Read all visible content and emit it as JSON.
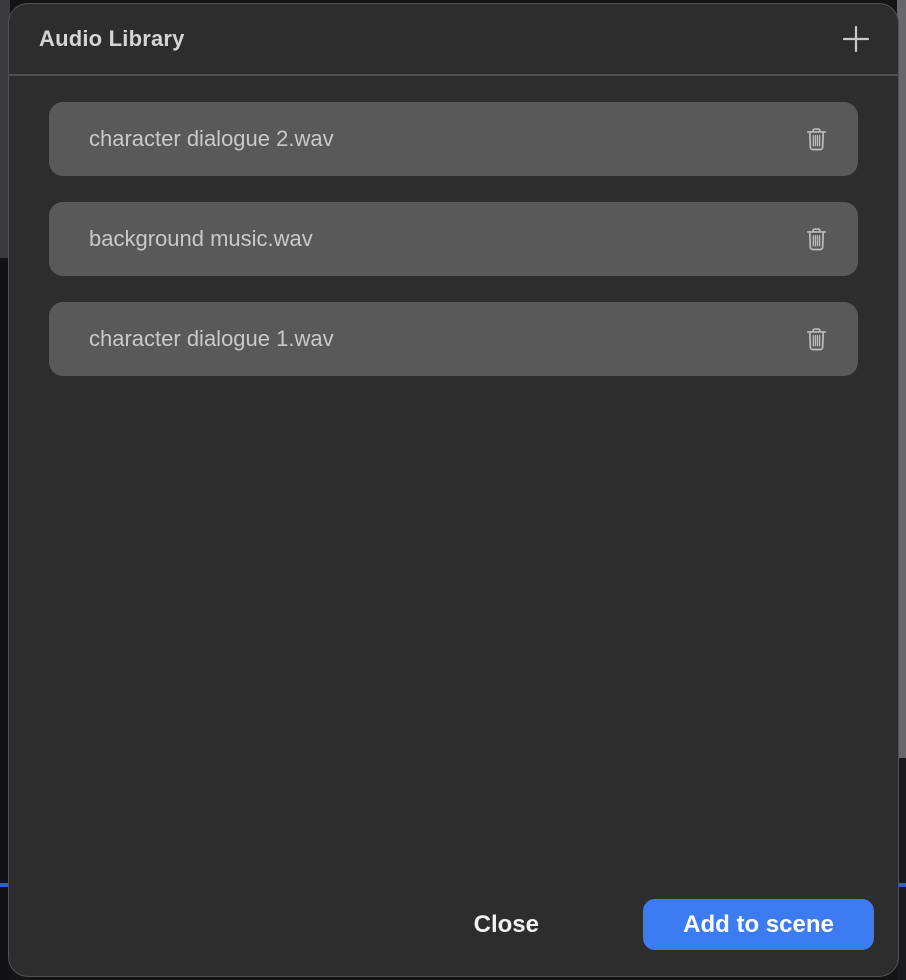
{
  "modal": {
    "title": "Audio Library",
    "footer": {
      "close_label": "Close",
      "add_to_scene_label": "Add to scene"
    }
  },
  "audio_library": {
    "items": [
      {
        "filename": "character dialogue 2.wav",
        "delete_icon": "trash-icon"
      },
      {
        "filename": "background music.wav",
        "delete_icon": "trash-icon"
      },
      {
        "filename": "character dialogue 1.wav",
        "delete_icon": "trash-icon"
      }
    ]
  },
  "icons": {
    "add": "plus-icon",
    "delete": "trash-icon"
  },
  "colors": {
    "modal_background": "#2d2d2e",
    "modal_border": "#515154",
    "item_background": "#595959",
    "item_text": "#c9c9c9",
    "title_text": "#d4d4d4",
    "divider": "#505052",
    "accent_blue": "#3d7bf2",
    "playhead_blue": "#2e62c4",
    "icon_gray": "#bcbcbc"
  }
}
